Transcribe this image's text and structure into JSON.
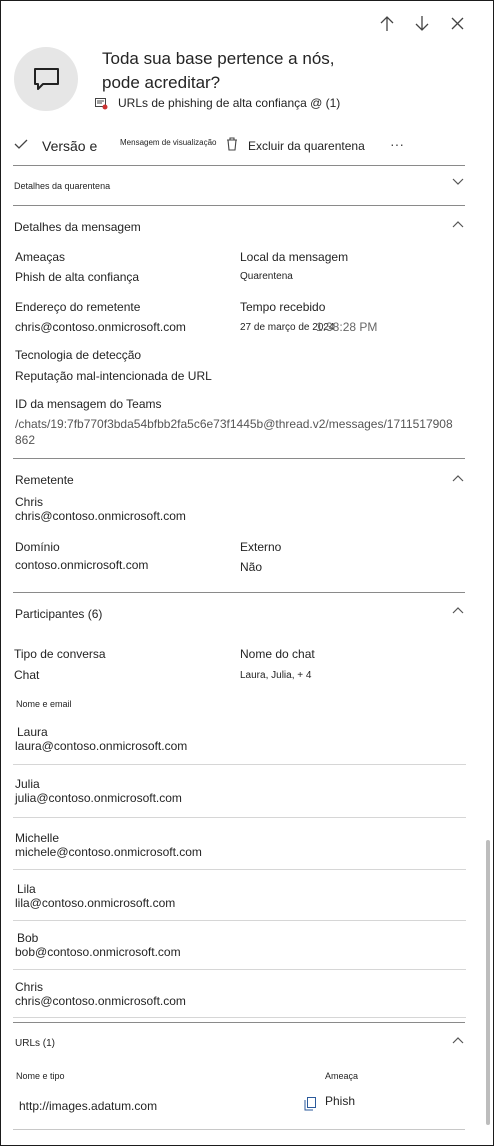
{
  "header": {
    "title_line1": "Toda sua base pertence a nós,",
    "title_line2": "pode acreditar?",
    "policy": "URLs de phishing de alta confiança @ (1)"
  },
  "toolbar": {
    "release_label": "Versão e",
    "preview_label": "Mensagem de visualização",
    "delete_label": "Excluir da quarentena",
    "more_label": "···"
  },
  "quarantine": {
    "title": "Detalhes da quarentena"
  },
  "message": {
    "title": "Detalhes da mensagem",
    "threats_label": "Ameaças",
    "threats_value": "Phish de alta confiança",
    "location_label": "Local da mensagem",
    "location_value": "Quarentena",
    "sender_address_label": "Endereço do remetente",
    "sender_address_value": "chris@contoso.onmicrosoft.com",
    "received_label": "Tempo recebido",
    "received_date": "27 de março de 2024",
    "received_time": "1:38:28 PM",
    "detection_label": "Tecnologia de detecção",
    "detection_value": "Reputação mal-intencionada de URL",
    "teams_id_label": "ID da mensagem do Teams",
    "teams_id_line1": "/chats/19:7fb770f3bda54bfbb2fa5c6e73f1445b@thread.v2/messages/1711517908",
    "teams_id_line2": "862"
  },
  "sender": {
    "title": "Remetente",
    "name": "Chris",
    "email": "chris@contoso.onmicrosoft.com",
    "domain_label": "Domínio",
    "domain_value": "contoso.onmicrosoft.com",
    "external_label": "Externo",
    "external_value": "Não"
  },
  "participants": {
    "title": "Participantes (6)",
    "conv_type_label": "Tipo de conversa",
    "conv_type_value": "Chat",
    "chat_name_label": "Nome do chat",
    "chat_name_value": "Laura, Julia, + 4",
    "list_header": "Nome e email",
    "people": [
      {
        "name": "Laura",
        "email": "laura@contoso.onmicrosoft.com"
      },
      {
        "name": "Julia",
        "email": "julia@contoso.onmicrosoft.com"
      },
      {
        "name": "Michelle",
        "email": "michele@contoso.onmicrosoft.com"
      },
      {
        "name": "Lila",
        "email": "lila@contoso.onmicrosoft.com"
      },
      {
        "name": "Bob",
        "email": "bob@contoso.onmicrosoft.com"
      },
      {
        "name": "Chris",
        "email": "chris@contoso.onmicrosoft.com"
      }
    ]
  },
  "urls": {
    "title": "URLs (1)",
    "col_name": "Nome e tipo",
    "col_threat": "Ameaça",
    "url": "http://images.adatum.com",
    "threat": "Phish"
  },
  "colors": {
    "avatar_bg": "#e6e6e6",
    "separator": "#8a8a8a",
    "link_grey": "#555555"
  },
  "icons": [
    "arrow-up-icon",
    "arrow-down-icon",
    "close-icon",
    "chat-bubble-icon",
    "policy-icon",
    "checkmark-icon",
    "trash-icon",
    "chevron-down-icon",
    "chevron-up-icon",
    "copy-icon"
  ]
}
